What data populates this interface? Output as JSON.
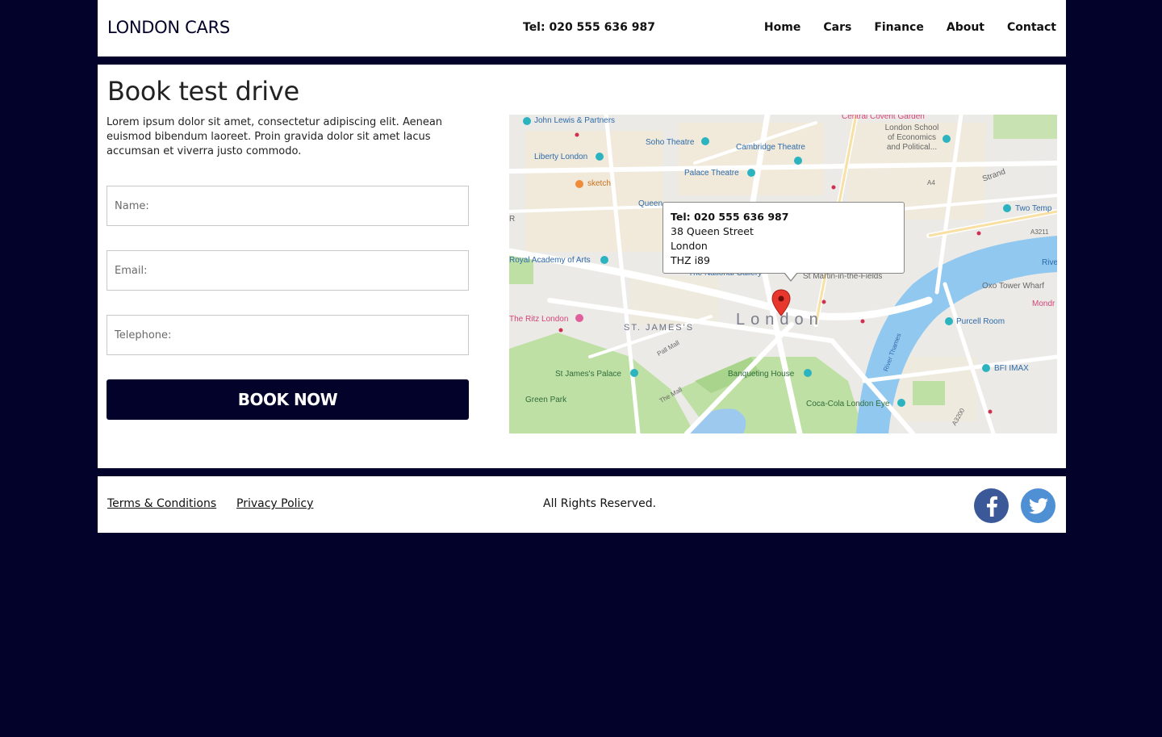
{
  "header": {
    "logo": "LONDON CARS",
    "tel": "Tel: 020 555 636 987",
    "nav": [
      "Home",
      "Cars",
      "Finance",
      "About",
      "Contact"
    ]
  },
  "main": {
    "title": "Book test drive",
    "intro": "Lorem ipsum dolor sit amet, consectetur adipiscing elit. Aenean euismod bibendum laoreet. Proin gravida dolor sit amet lacus accumsan et viverra justo commodo.",
    "form": {
      "name_placeholder": "Name:",
      "email_placeholder": "Email:",
      "telephone_placeholder": "Telephone:",
      "submit_label": "BOOK NOW"
    }
  },
  "map": {
    "infobox": {
      "tel": "Tel: 020 555 636 987",
      "street": "38 Queen Street",
      "city": "London",
      "postcode": "THZ i89"
    },
    "city_label": "London",
    "district_label": "ST. JAMES'S",
    "labels": {
      "john_lewis": "John Lewis & Partners",
      "covent_garden": "Central Covent Garden",
      "lse": "London School of Economics and Political...",
      "soho_theatre": "Soho Theatre",
      "cambridge_theatre": "Cambridge Theatre",
      "liberty": "Liberty London",
      "palace_theatre": "Palace Theatre",
      "sketch": "sketch",
      "queen": "Queen",
      "strand": "Strand",
      "two_temple": "Two Temp",
      "a4": "A4",
      "a3211": "A3211",
      "royal_academy": "Royal Academy of Arts",
      "national_gallery": "The National Gallery",
      "st_martin": "St Martin-in-the-Fields",
      "river": "Rive",
      "oxo": "Oxo Tower Wharf",
      "mondr": "Mondr",
      "ritz": "The Ritz London",
      "purcell": "Purcell Room",
      "pall_mall": "Pall Mall",
      "river_thames": "River Thames",
      "st_james_palace": "St James's Palace",
      "banqueting": "Banqueting House",
      "bfi": "BFI IMAX",
      "green_park": "Green Park",
      "the_mall": "The Mall",
      "eye": "Coca-Cola London Eye",
      "a3200": "A3200",
      "r": "R"
    }
  },
  "footer": {
    "terms": "Terms & Conditions",
    "privacy": "Privacy Policy",
    "rights": "All Rights Reserved."
  },
  "colors": {
    "brand_navy": "#02022a",
    "facebook": "#3b5998",
    "twitter": "#4f8fd4"
  },
  "icons": {
    "facebook": "facebook-icon",
    "twitter": "twitter-icon",
    "map_pin": "map-pin-icon"
  }
}
